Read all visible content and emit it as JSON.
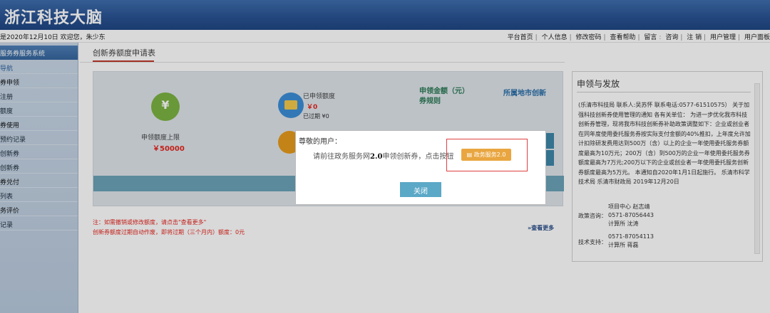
{
  "header": {
    "logo": "浙江科技大脑"
  },
  "topbar": {
    "greeting": "是2020年12月10日 欢迎您，朱少东",
    "links": [
      "平台首页",
      "个人信息",
      "修改密码",
      "查看帮助",
      "留言",
      "咨询",
      "注 销",
      "用户管理",
      "用户面板"
    ]
  },
  "sidebar": {
    "system_title": "服务券服务系统",
    "items": [
      "导航",
      "券申领",
      "注册",
      "额度",
      "券使用",
      "预约记录",
      "创新券",
      "创新券",
      "券兑付",
      "列表",
      "务评价",
      "记录"
    ]
  },
  "main": {
    "tab_label": "创新券额度申请表",
    "limit_label": "申领额度上限",
    "limit_value": "￥50000",
    "claimed_label": "已申领额度",
    "claimed_value": "￥0",
    "expired_text": "已过期 ¥0",
    "col_amount": "申领金额（元）",
    "col_rules": "券规则",
    "col_area": "所属地市创新",
    "note1": "注：如需撤销或修改额度，请点击\"查看更多\"",
    "note2": "创新券额度过期自动作废，即将过期（三个月内）额度：0元",
    "more_link": "»查看更多"
  },
  "right_panel": {
    "title": "申领与发放",
    "body": "(乐清市科技局 联系人:吴苏怀 联系电话:0577-61510575）  关于加强科技创新券使用管理的通知 各有关单位： 为进一步优化我市科技创新券管理，现将我市科技创新券补助政策调整如下：企业或创业者在同年度使用委托服务券按实际支付金额的40%推扣，上年度允许加计扣除研发费用达到500万（含）以上的企业一年使用委托服务券额度最高为10万元；200万（含）到500万的企业一年使用委托服务券额度最高为7万元;200万以下的企业或创业者一年使用委托服务创新券额度最高为5万元。 本通知自2020年1月1日起施行。 乐清市科学技术局 乐清市财政局 2019年12月20日",
    "policy_label": "政策咨询：",
    "policy_lines": [
      "项目中心 赵志靖",
      "0571-87056443",
      "计算所 沈涛"
    ],
    "tech_label": "技术支持：",
    "tech_lines": [
      "0571-87054113",
      "计算所 蒋磊"
    ]
  },
  "modal": {
    "greeting": "尊敬的用户：",
    "message_prefix": "请前往政务服务网",
    "message_version": "2.0",
    "message_suffix": "申领创新券，点击按钮",
    "gov_button": "政务服务2.0",
    "close_button": "关闭"
  },
  "colors": {
    "header_blue": "#2a5494",
    "accent_red": "#e5261e",
    "close_button": "#5ba8c7",
    "gov_button": "#e9a640"
  }
}
